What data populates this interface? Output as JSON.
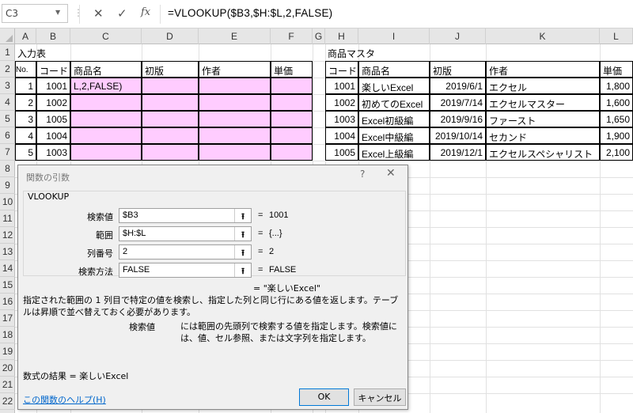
{
  "formula_bar": {
    "name_box": "C3",
    "cancel_icon": "✕",
    "enter_icon": "✓",
    "fx_icon": "fx",
    "formula": "=VLOOKUP($B3,$H:$L,2,FALSE)"
  },
  "columns": [
    "A",
    "B",
    "C",
    "D",
    "E",
    "F",
    "G",
    "H",
    "I",
    "J",
    "K",
    "L"
  ],
  "rows": [
    "1",
    "2",
    "3",
    "4",
    "5",
    "6",
    "7",
    "8",
    "9",
    "10",
    "11",
    "12",
    "13",
    "14",
    "15",
    "16",
    "17",
    "18",
    "19",
    "20",
    "21",
    "22"
  ],
  "sheet": {
    "input_title": "入力表",
    "input_headers": [
      "No.",
      "コード",
      "商品名",
      "初版",
      "作者",
      "単価"
    ],
    "input_rows": [
      {
        "no": "1",
        "code": "1001",
        "name": "L,2,FALSE)"
      },
      {
        "no": "2",
        "code": "1002",
        "name": ""
      },
      {
        "no": "3",
        "code": "1005",
        "name": ""
      },
      {
        "no": "4",
        "code": "1004",
        "name": ""
      },
      {
        "no": "5",
        "code": "1003",
        "name": ""
      }
    ],
    "master_title": "商品マスタ",
    "master_headers": [
      "コード",
      "商品名",
      "初版",
      "作者",
      "単価"
    ],
    "master_rows": [
      {
        "code": "1001",
        "name": "楽しいExcel",
        "date": "2019/6/1",
        "author": "エクセル",
        "price": "1,800"
      },
      {
        "code": "1002",
        "name": "初めてのExcel",
        "date": "2019/7/14",
        "author": "エクセルマスター",
        "price": "1,600"
      },
      {
        "code": "1003",
        "name": "Excel初級編",
        "date": "2019/9/16",
        "author": "ファースト",
        "price": "1,650"
      },
      {
        "code": "1004",
        "name": "Excel中級編",
        "date": "2019/10/14",
        "author": "セカンド",
        "price": "1,900"
      },
      {
        "code": "1005",
        "name": "Excel上級編",
        "date": "2019/12/1",
        "author": "エクセルスペシャリスト",
        "price": "2,100"
      }
    ]
  },
  "dialog": {
    "title": "関数の引数",
    "help_icon": "?",
    "close_icon": "✕",
    "function_name": "VLOOKUP",
    "args": [
      {
        "label": "検索値",
        "value": "$B3",
        "result": "1001"
      },
      {
        "label": "範囲",
        "value": "$H:$L",
        "result": "{...}"
      },
      {
        "label": "列番号",
        "value": "2",
        "result": "2"
      },
      {
        "label": "検索方法",
        "value": "FALSE",
        "result": "FALSE"
      }
    ],
    "collapse_glyph": "⭱",
    "equals": "=",
    "function_result_line": "=  \"楽しいExcel\"",
    "description": "指定された範囲の 1 列目で特定の値を検索し、指定した列と同じ行にある値を返します。テーブルは昇順で並べ替えておく必要があります。",
    "arg_desc_name": "検索値",
    "arg_description": "には範囲の先頭列で検索する値を指定します。検索値には、値、セル参照、または文字列を指定します。",
    "formula_result": "数式の結果 =   楽しいExcel",
    "help_link": "この関数のヘルプ(H)",
    "ok_label": "OK",
    "cancel_label": "キャンセル"
  }
}
